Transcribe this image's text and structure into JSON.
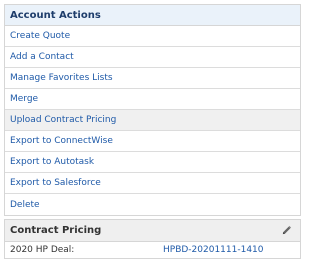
{
  "account_actions": {
    "title": "Account Actions",
    "items": [
      {
        "label": "Create Quote"
      },
      {
        "label": "Add a Contact"
      },
      {
        "label": "Manage Favorites Lists"
      },
      {
        "label": "Merge"
      },
      {
        "label": "Upload Contract Pricing",
        "highlighted": true
      },
      {
        "label": "Export to ConnectWise"
      },
      {
        "label": "Export to Autotask"
      },
      {
        "label": "Export to Salesforce"
      },
      {
        "label": "Delete"
      }
    ]
  },
  "contract_pricing": {
    "title": "Contract Pricing",
    "edit_icon": "pencil-icon",
    "rows": [
      {
        "label": "2020 HP Deal:",
        "value": "HPBD-20201111-1410"
      }
    ]
  },
  "colors": {
    "link": "#1f5aa8",
    "header_blue_bg": "#eaf2fa",
    "header_grey_bg": "#efefef",
    "highlight_row": "#f0f0f0",
    "border": "#d6d6d6"
  }
}
